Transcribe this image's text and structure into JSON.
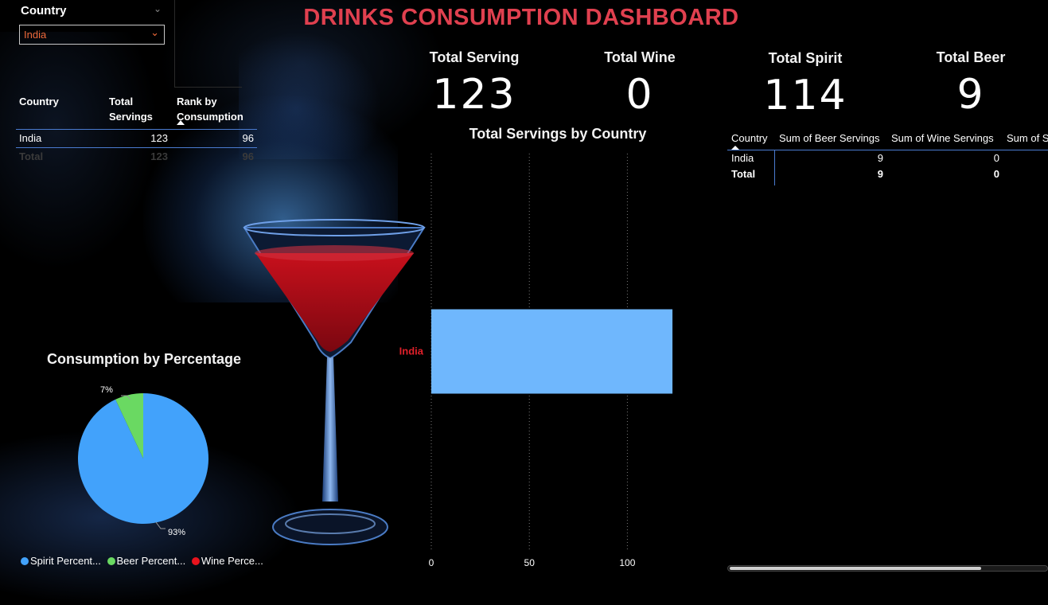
{
  "title": "DRINKS CONSUMPTION DASHBOARD",
  "slicer": {
    "header": "Country",
    "selected": "India"
  },
  "left_table": {
    "headers": {
      "country": "Country",
      "total": "Total Servings",
      "rank": "Rank by Consumption"
    },
    "row": {
      "country": "India",
      "total": "123",
      "rank": "96"
    },
    "total_row": {
      "label": "Total",
      "total": "123",
      "rank": "96"
    }
  },
  "kpis": [
    {
      "label": "Total Serving",
      "value": "123"
    },
    {
      "label": "Total Wine",
      "value": "0"
    },
    {
      "label": "Total Spirit",
      "value": "114"
    },
    {
      "label": "Total Beer",
      "value": "9"
    }
  ],
  "bar_chart": {
    "title": "Total Servings by Country",
    "category_color": "#e0202a",
    "bar_color": "#6fb7fd"
  },
  "right_table": {
    "headers": [
      "Country",
      "Sum of Beer Servings",
      "Sum of Wine Servings",
      "Sum of S"
    ],
    "row": [
      "India",
      "9",
      "0"
    ],
    "total_row": [
      "Total",
      "9",
      "0"
    ]
  },
  "pie": {
    "title": "Consumption by Percentage",
    "labels": {
      "spirit": "93%",
      "beer": "7%"
    },
    "legend": [
      {
        "label": "Spirit Percent...",
        "color": "#42a2fb"
      },
      {
        "label": "Beer Percent...",
        "color": "#6ad962"
      },
      {
        "label": "Wine Perce...",
        "color": "#e8131d"
      }
    ]
  },
  "chart_data": [
    {
      "type": "bar",
      "title": "Total Servings by Country",
      "categories": [
        "India"
      ],
      "values": [
        123
      ],
      "xlim": [
        0,
        125
      ],
      "xticks": [
        0,
        50,
        100
      ],
      "orientation": "horizontal",
      "grid": true
    },
    {
      "type": "pie",
      "title": "Consumption by Percentage",
      "categories": [
        "Spirit Percent...",
        "Beer Percent...",
        "Wine Perce..."
      ],
      "values": [
        93,
        7,
        0
      ],
      "data_labels": [
        "93%",
        "7%"
      ]
    }
  ]
}
